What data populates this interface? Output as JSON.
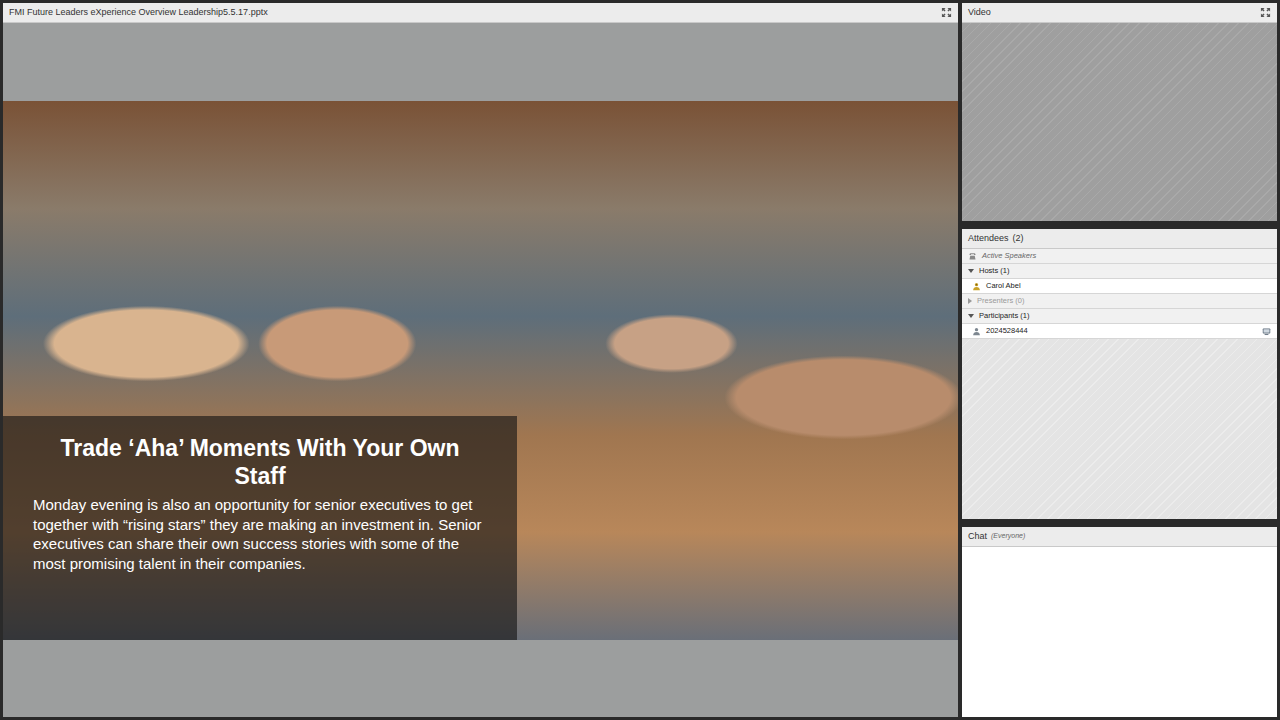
{
  "presentation": {
    "title": "FMI Future Leaders eXperience Overview Leadership5.5.17.pptx",
    "slide": {
      "heading": "Trade ‘Aha’ Moments With Your Own Staff",
      "body": "Monday evening is also an opportunity for senior executives to get together with “rising stars” they are making an investment in. Senior executives can share their own success stories with some of the most promising talent in their companies."
    }
  },
  "video": {
    "title": "Video"
  },
  "attendees": {
    "title": "Attendees",
    "count": "(2)",
    "groups": [
      {
        "kind": "speakers",
        "label": "Active Speakers"
      },
      {
        "kind": "group",
        "label": "Hosts (1)",
        "expanded": true,
        "disabled": false,
        "members": [
          {
            "name": "Carol Abel",
            "kind": "host"
          }
        ]
      },
      {
        "kind": "group",
        "label": "Presenters (0)",
        "expanded": false,
        "disabled": true,
        "members": []
      },
      {
        "kind": "group",
        "label": "Participants (1)",
        "expanded": true,
        "disabled": false,
        "members": [
          {
            "name": "2024528444",
            "kind": "participant"
          }
        ]
      }
    ]
  },
  "chat": {
    "title": "Chat",
    "scope": "(Everyone)"
  }
}
